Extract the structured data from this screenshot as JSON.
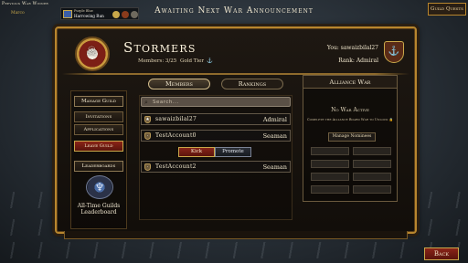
{
  "top_bar": {
    "previous_winner_label": "Previous War Winner",
    "previous_winner_name": "Marco",
    "badge_line1": "Purple Blue",
    "badge_name": "Harrowing Run",
    "war_title": "Awaiting Next War Announcement",
    "guild_quests_label": "Guild Quests"
  },
  "guild": {
    "name": "Stormers",
    "members_stat": "Members: 3/25",
    "tier": "Gold Tier"
  },
  "player": {
    "you_text": "You: sawaizbilal27",
    "rank_text": "Rank: Admiral"
  },
  "left_nav": {
    "manage_guild": "Manage Guild",
    "invitations": "Invitations",
    "applications": "Applications",
    "leave_guild": "Leave Guild",
    "leaderboards": "Leaderboards",
    "all_time": "All-Time Guilds Leaderboard"
  },
  "tabs": {
    "members": "Members",
    "rankings": "Rankings"
  },
  "search": {
    "placeholder": "Search..."
  },
  "members": [
    {
      "name": "sawaizbilal27",
      "rank": "Admiral"
    },
    {
      "name": "TestAccount0",
      "rank": "Seaman"
    },
    {
      "name": "TestAccount2",
      "rank": "Seaman"
    }
  ],
  "member_actions": {
    "kick": "Kick",
    "promote": "Promote"
  },
  "alliance": {
    "title": "Alliance War",
    "status": "No War Active",
    "complete_text": "Complete the Alliance Board War to Unlock",
    "lock_symbol": "🔒",
    "manage_nominees": "Manage Nominees"
  },
  "back_label": "Back"
}
